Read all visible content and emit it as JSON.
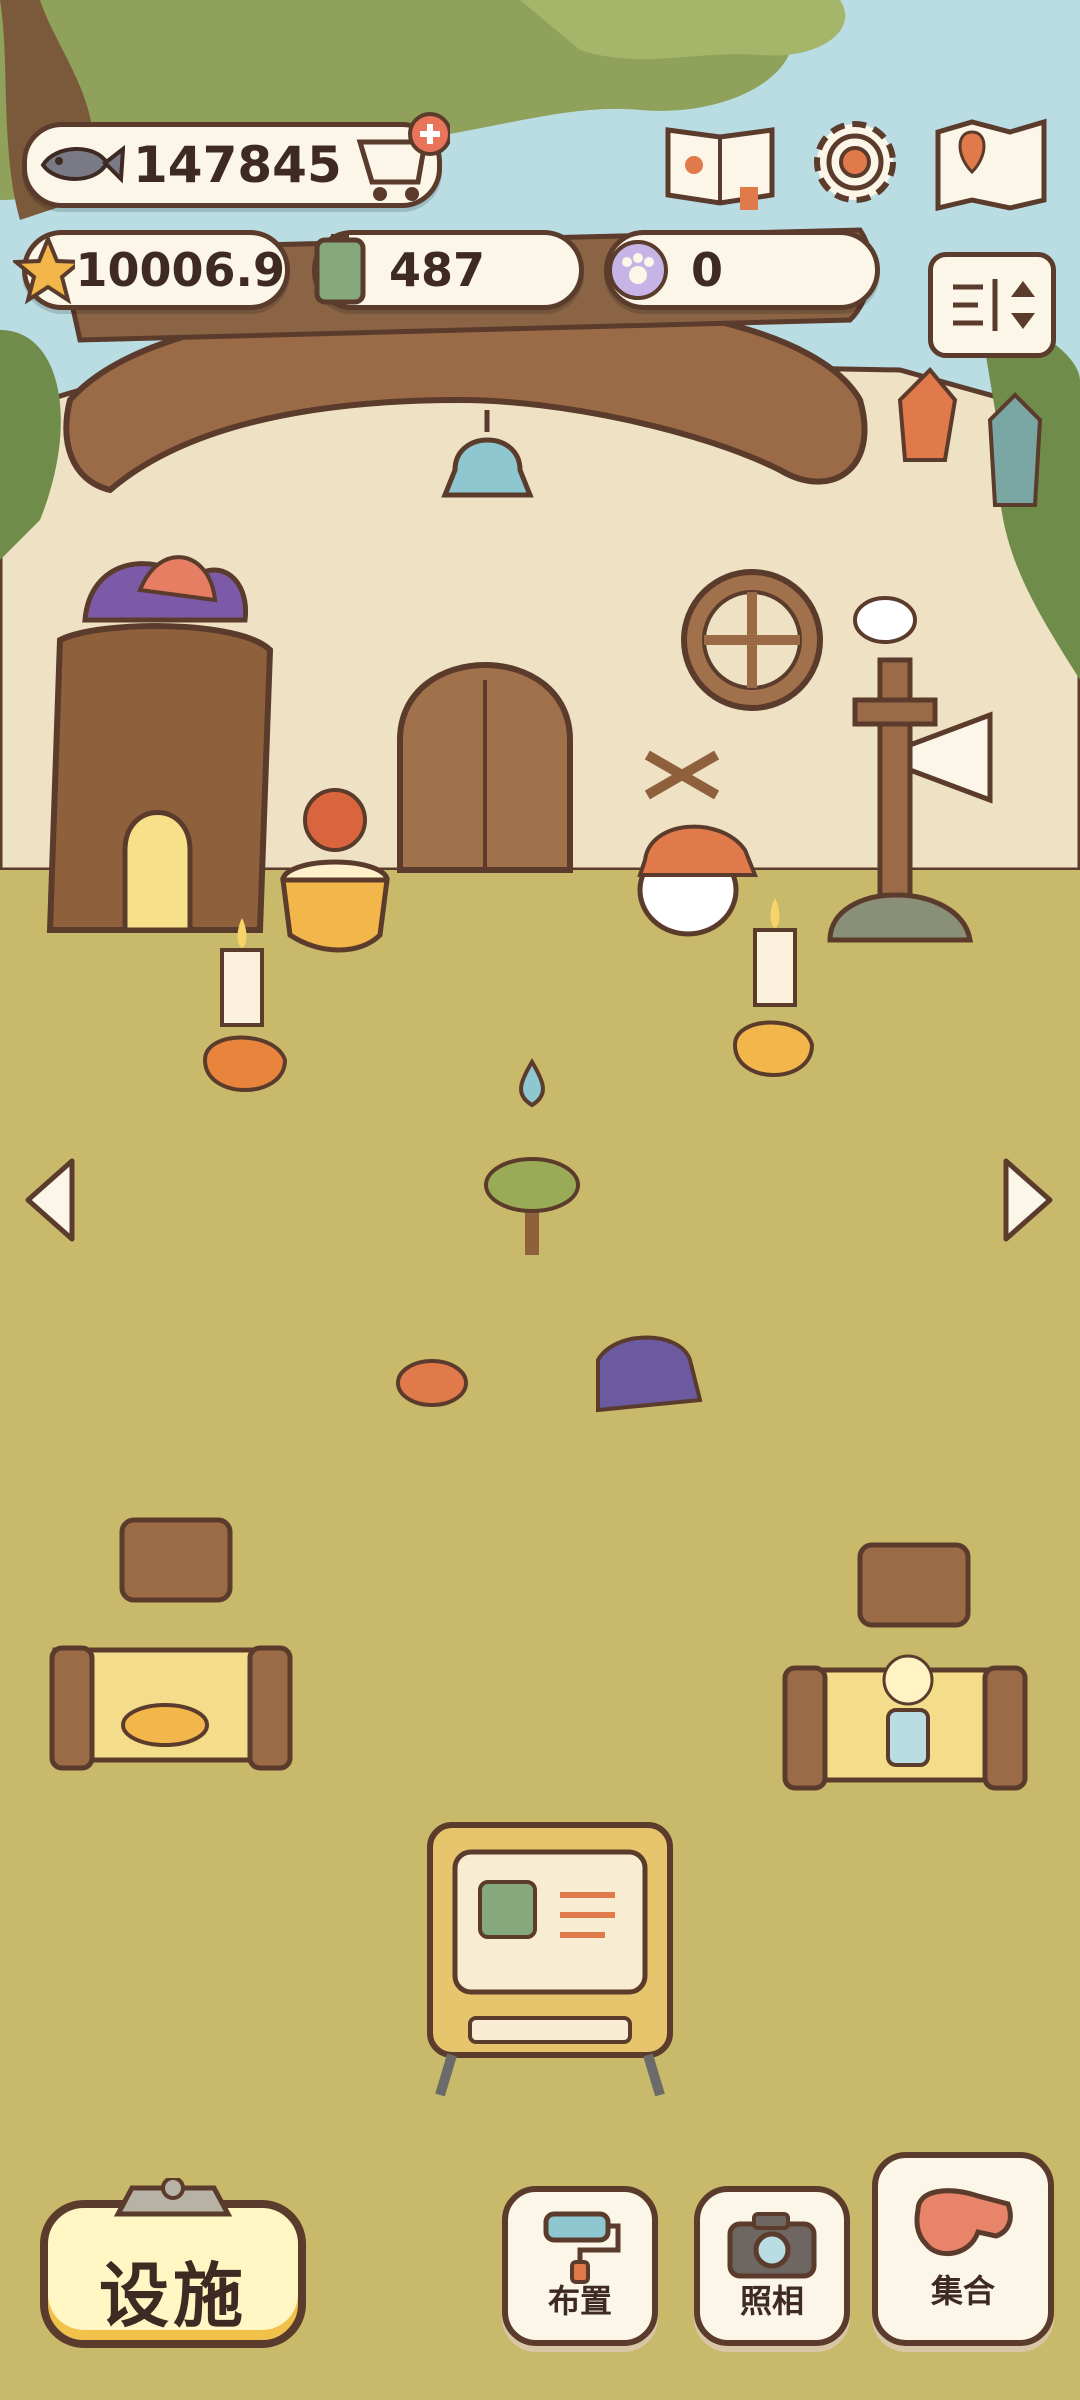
{
  "hud": {
    "fish_count": "147845",
    "star_count": "10006.9",
    "battery_count": "487",
    "paw_count": "0"
  },
  "icons": {
    "fish": "fish-icon",
    "cart": "shopping-cart-plus-icon",
    "book": "paw-book-icon",
    "gear": "gear-icon",
    "map": "map-pin-icon",
    "star": "star-icon",
    "battery": "battery-icon",
    "paw": "paw-coin-icon",
    "sort": "sort-toggle-icon"
  },
  "buttons": {
    "facility": "设施",
    "layout": "布置",
    "photo": "照相",
    "gather": "集合"
  },
  "colors": {
    "grass": "#c9b96a",
    "sky": "#b9dde3",
    "wall": "#efe1c3",
    "wood": "#9a6b46",
    "outline": "#5b3b2b",
    "button_cream": "#fbf6e8",
    "button_yellow": "#fff6c4"
  }
}
